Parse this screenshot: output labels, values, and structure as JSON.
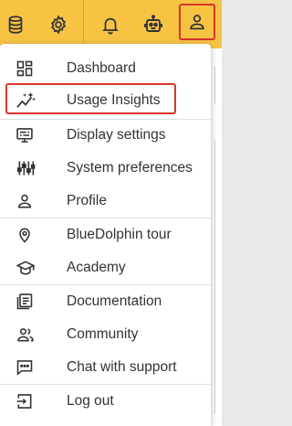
{
  "toolbar": {
    "buttons": [
      {
        "icon": "database-icon"
      },
      {
        "icon": "gear-icon"
      },
      {
        "icon": "bell-icon"
      },
      {
        "icon": "robot-icon"
      },
      {
        "icon": "user-icon",
        "active": true
      }
    ],
    "background_color": "#f6c343",
    "highlight_color": "#d9342b"
  },
  "menu": {
    "items": [
      {
        "label": "Dashboard",
        "icon": "dashboard-icon"
      },
      {
        "label": "Usage Insights",
        "icon": "insights-sparkle-icon",
        "highlighted": true
      },
      {
        "label": "Display settings",
        "icon": "display-settings-icon"
      },
      {
        "label": "System preferences",
        "icon": "sliders-icon"
      },
      {
        "label": "Profile",
        "icon": "person-icon"
      },
      {
        "label": "BlueDolphin tour",
        "icon": "location-pin-icon"
      },
      {
        "label": "Academy",
        "icon": "graduation-cap-icon"
      },
      {
        "label": "Documentation",
        "icon": "documentation-icon"
      },
      {
        "label": "Community",
        "icon": "community-icon"
      },
      {
        "label": "Chat with support",
        "icon": "chat-icon"
      },
      {
        "label": "Log out",
        "icon": "logout-icon"
      }
    ]
  }
}
